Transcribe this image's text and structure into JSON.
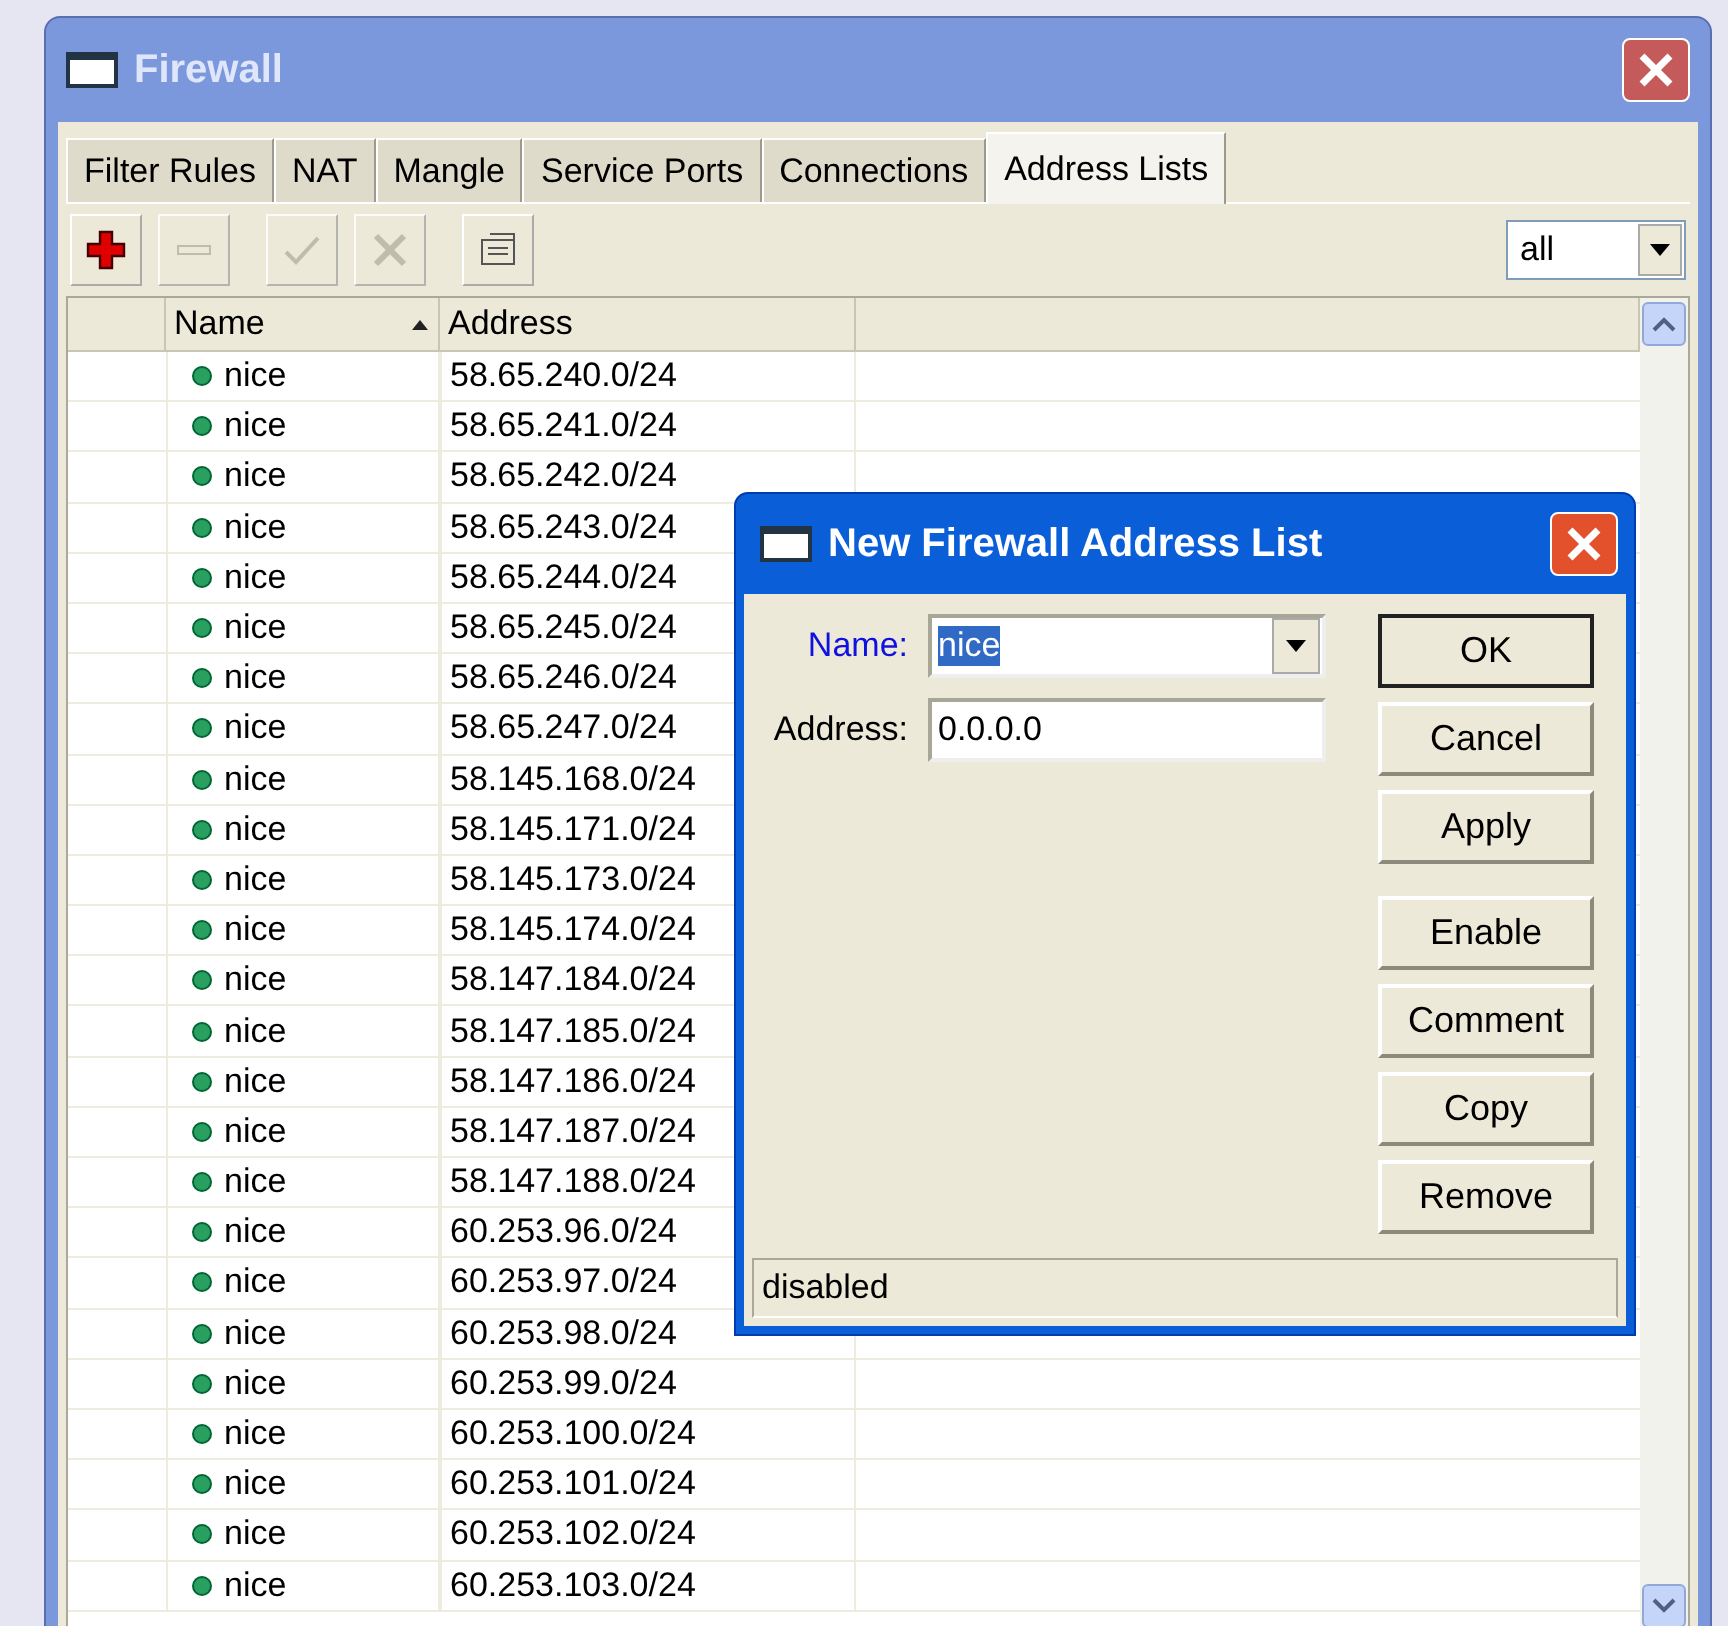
{
  "window": {
    "title": "Firewall"
  },
  "tabs": [
    {
      "label": "Filter Rules",
      "selected": false
    },
    {
      "label": "NAT",
      "selected": false
    },
    {
      "label": "Mangle",
      "selected": false
    },
    {
      "label": "Service Ports",
      "selected": false
    },
    {
      "label": "Connections",
      "selected": false
    },
    {
      "label": "Address Lists",
      "selected": true
    }
  ],
  "toolbar": [
    {
      "kind": "add",
      "disabled": false
    },
    {
      "kind": "remove",
      "disabled": true
    },
    {
      "kind": "enable",
      "disabled": true
    },
    {
      "kind": "disable",
      "disabled": true
    },
    {
      "kind": "comment",
      "disabled": false
    }
  ],
  "filter": {
    "value": "all"
  },
  "table": {
    "columns": [
      {
        "label": "Name",
        "sorted": true
      },
      {
        "label": "Address",
        "sorted": false
      }
    ],
    "rows": [
      {
        "name": "nice",
        "address": "58.65.240.0/24",
        "enabled": true
      },
      {
        "name": "nice",
        "address": "58.65.241.0/24",
        "enabled": true
      },
      {
        "name": "nice",
        "address": "58.65.242.0/24",
        "enabled": true
      },
      {
        "name": "nice",
        "address": "58.65.243.0/24",
        "enabled": true
      },
      {
        "name": "nice",
        "address": "58.65.244.0/24",
        "enabled": true
      },
      {
        "name": "nice",
        "address": "58.65.245.0/24",
        "enabled": true
      },
      {
        "name": "nice",
        "address": "58.65.246.0/24",
        "enabled": true
      },
      {
        "name": "nice",
        "address": "58.65.247.0/24",
        "enabled": true
      },
      {
        "name": "nice",
        "address": "58.145.168.0/24",
        "enabled": true
      },
      {
        "name": "nice",
        "address": "58.145.171.0/24",
        "enabled": true
      },
      {
        "name": "nice",
        "address": "58.145.173.0/24",
        "enabled": true
      },
      {
        "name": "nice",
        "address": "58.145.174.0/24",
        "enabled": true
      },
      {
        "name": "nice",
        "address": "58.147.184.0/24",
        "enabled": true
      },
      {
        "name": "nice",
        "address": "58.147.185.0/24",
        "enabled": true
      },
      {
        "name": "nice",
        "address": "58.147.186.0/24",
        "enabled": true
      },
      {
        "name": "nice",
        "address": "58.147.187.0/24",
        "enabled": true
      },
      {
        "name": "nice",
        "address": "58.147.188.0/24",
        "enabled": true
      },
      {
        "name": "nice",
        "address": "60.253.96.0/24",
        "enabled": true
      },
      {
        "name": "nice",
        "address": "60.253.97.0/24",
        "enabled": true
      },
      {
        "name": "nice",
        "address": "60.253.98.0/24",
        "enabled": true
      },
      {
        "name": "nice",
        "address": "60.253.99.0/24",
        "enabled": true
      },
      {
        "name": "nice",
        "address": "60.253.100.0/24",
        "enabled": true
      },
      {
        "name": "nice",
        "address": "60.253.101.0/24",
        "enabled": true
      },
      {
        "name": "nice",
        "address": "60.253.102.0/24",
        "enabled": true
      },
      {
        "name": "nice",
        "address": "60.253.103.0/24",
        "enabled": true
      }
    ]
  },
  "dialog": {
    "title": "New Firewall Address List",
    "fields": [
      {
        "kind": "combo",
        "label": "Name:",
        "value": "nice",
        "focused": true
      },
      {
        "kind": "text",
        "label": "Address:",
        "value": "0.0.0.0",
        "focused": false
      }
    ],
    "buttons": [
      {
        "label": "OK",
        "default": true
      },
      {
        "label": "Cancel",
        "default": false
      },
      {
        "label": "Apply",
        "default": false
      },
      {
        "label": "Enable",
        "default": false
      },
      {
        "label": "Comment",
        "default": false
      },
      {
        "label": "Copy",
        "default": false
      },
      {
        "label": "Remove",
        "default": false
      }
    ],
    "status": "disabled"
  }
}
